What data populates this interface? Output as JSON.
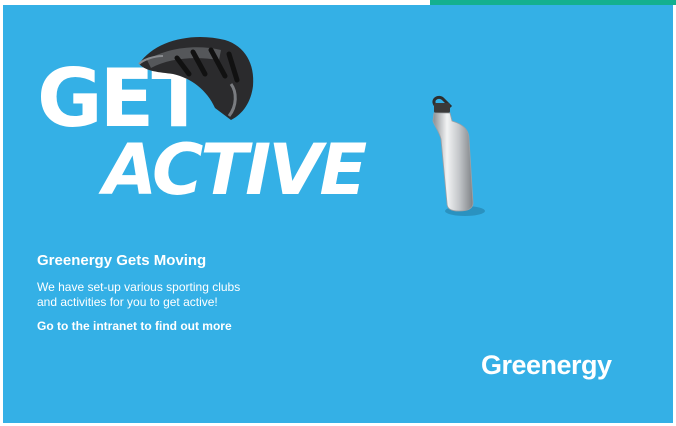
{
  "poster": {
    "headline_line1": "GET",
    "headline_line2": "ACTIVE",
    "subtitle": "Greenergy Gets Moving",
    "body_line1": "We have set-up various sporting clubs",
    "body_line2": "and activities for you to get active!",
    "call_to_action": "Go to the intranet to find out more",
    "logo_text": "Greenergy"
  },
  "colors": {
    "background": "#34b0e6",
    "text": "#ffffff",
    "top_strip": "#14b08f"
  },
  "icons": [
    "bike-helmet-icon",
    "water-bottle-icon"
  ]
}
